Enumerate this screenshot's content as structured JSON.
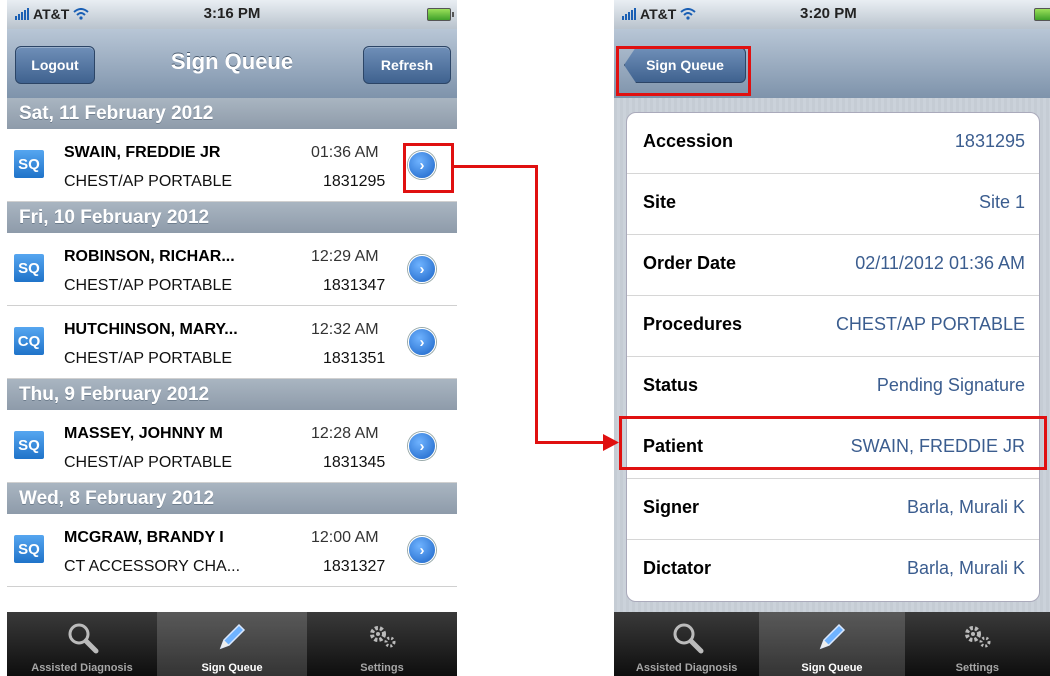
{
  "left_screen": {
    "status_bar": {
      "carrier": "AT&T",
      "time": "3:16 PM"
    },
    "navbar": {
      "title": "Sign Queue",
      "logout_label": "Logout",
      "refresh_label": "Refresh"
    },
    "sections": [
      {
        "header": "Sat, 11 February 2012",
        "rows": [
          {
            "badge": "SQ",
            "patient": "SWAIN, FREDDIE JR",
            "time": "01:36 AM",
            "procedure": "CHEST/AP PORTABLE",
            "accession": "1831295"
          }
        ]
      },
      {
        "header": "Fri, 10 February 2012",
        "rows": [
          {
            "badge": "SQ",
            "patient": "ROBINSON, RICHAR...",
            "time": "12:29 AM",
            "procedure": "CHEST/AP PORTABLE",
            "accession": "1831347"
          },
          {
            "badge": "CQ",
            "patient": "HUTCHINSON, MARY...",
            "time": "12:32 AM",
            "procedure": "CHEST/AP PORTABLE",
            "accession": "1831351"
          }
        ]
      },
      {
        "header": "Thu, 9 February 2012",
        "rows": [
          {
            "badge": "SQ",
            "patient": "MASSEY, JOHNNY M",
            "time": "12:28 AM",
            "procedure": "CHEST/AP PORTABLE",
            "accession": "1831345"
          }
        ]
      },
      {
        "header": "Wed, 8 February 2012",
        "rows": [
          {
            "badge": "SQ",
            "patient": "MCGRAW, BRANDY I",
            "time": "12:00 AM",
            "procedure": "CT ACCESSORY CHA...",
            "accession": "1831327"
          }
        ]
      }
    ],
    "tabs": [
      {
        "label": "Assisted Diagnosis",
        "icon": "magnifier-icon",
        "selected": false
      },
      {
        "label": "Sign Queue",
        "icon": "pencil-icon",
        "selected": true
      },
      {
        "label": "Settings",
        "icon": "gears-icon",
        "selected": false
      }
    ]
  },
  "right_screen": {
    "status_bar": {
      "carrier": "AT&T",
      "time": "3:20 PM"
    },
    "navbar": {
      "back_label": "Sign Queue"
    },
    "details": [
      {
        "label": "Accession",
        "value": "1831295"
      },
      {
        "label": "Site",
        "value": "Site 1"
      },
      {
        "label": "Order Date",
        "value": "02/11/2012 01:36 AM"
      },
      {
        "label": "Procedures",
        "value": "CHEST/AP PORTABLE"
      },
      {
        "label": "Status",
        "value": "Pending Signature"
      },
      {
        "label": "Patient",
        "value": "SWAIN, FREDDIE JR"
      },
      {
        "label": "Signer",
        "value": "Barla, Murali K"
      },
      {
        "label": "Dictator",
        "value": "Barla, Murali K"
      }
    ],
    "tabs": [
      {
        "label": "Assisted Diagnosis",
        "icon": "magnifier-icon",
        "selected": false
      },
      {
        "label": "Sign Queue",
        "icon": "pencil-icon",
        "selected": true
      },
      {
        "label": "Settings",
        "icon": "gears-icon",
        "selected": false
      }
    ]
  },
  "colors": {
    "highlight": "#e01010",
    "detail_value": "#3b5d8f",
    "badge": "#1f73c9"
  }
}
